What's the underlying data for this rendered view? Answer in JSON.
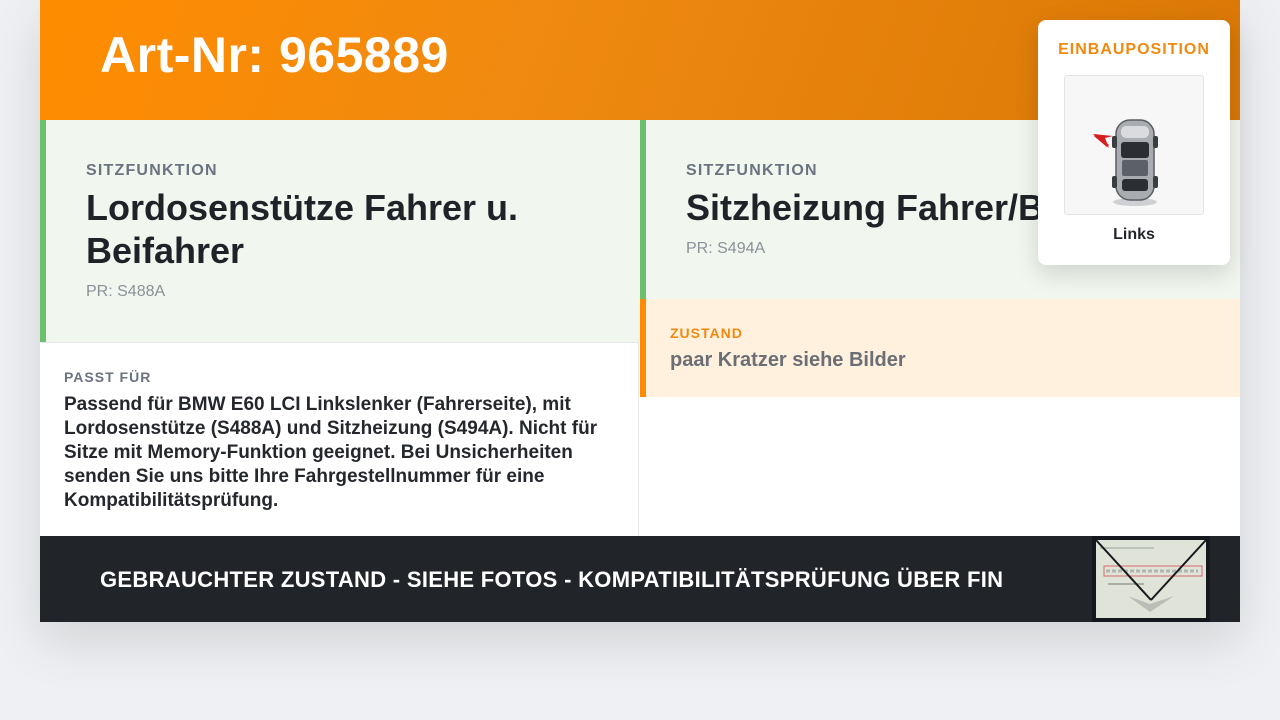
{
  "header": {
    "art_nr": "Art-Nr: 965889"
  },
  "functions": [
    {
      "label": "SITZFUNKTION",
      "title": "Lordosenstütze Fahrer u. Beifahrer",
      "pr": "PR: S488A"
    },
    {
      "label": "SITZFUNKTION",
      "title": "Sitzheizung Fahrer/Beifahrer",
      "pr": "PR: S494A"
    }
  ],
  "passt_fuer": {
    "label": "PASST FÜR",
    "text": "Passend für BMW E60 LCI Linkslenker (Fahrerseite), mit Lordosenstütze (S488A) und Sitzheizung (S494A). Nicht für Sitze mit Memory-Funktion geeignet. Bei Unsicherheiten senden Sie uns bitte Ihre Fahrgestellnummer für eine Kompatibilitätsprüfung."
  },
  "zustand": {
    "label": "ZUSTAND",
    "text": "paar Kratzer siehe Bilder"
  },
  "footer": {
    "text": "GEBRAUCHTER ZUSTAND - SIEHE FOTOS - KOMPATIBILITÄTSPRÜFUNG ÜBER FIN",
    "thumb_icon": "vin-envelope-photo"
  },
  "einbauposition": {
    "label": "EINBAUPOSITION",
    "position": "Links",
    "icon": "car-top-view-icon"
  },
  "colors": {
    "accent": "#ff8c00",
    "function_border": "#6cc06c",
    "function_bg": "#f1f7ef",
    "zustand_bg": "#fff1de",
    "footer_bg": "#212429"
  }
}
